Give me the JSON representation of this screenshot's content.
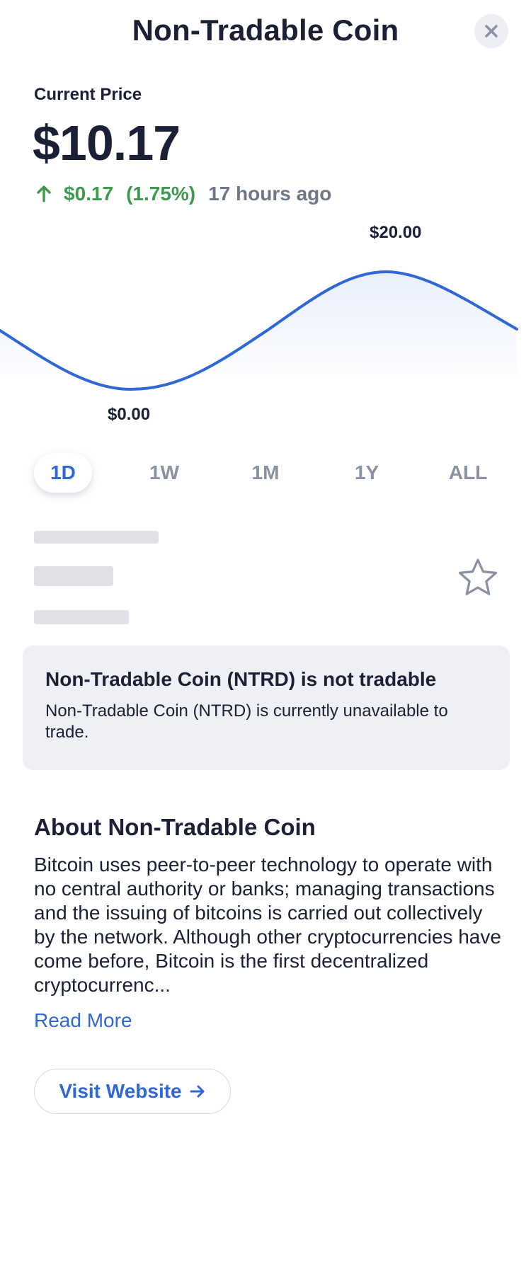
{
  "header": {
    "title": "Non-Tradable Coin"
  },
  "price": {
    "label": "Current Price",
    "value": "$10.17",
    "change_amount": "$0.17",
    "change_percent": "(1.75%)",
    "change_time": "17 hours ago",
    "change_direction": "up"
  },
  "chart_data": {
    "type": "line",
    "max_label": "$20.00",
    "min_label": "$0.00",
    "y_range": [
      0,
      20
    ],
    "line_color": "#2f67d8",
    "fill": "gradient-light-blue"
  },
  "range_tabs": {
    "items": [
      {
        "label": "1D",
        "active": true
      },
      {
        "label": "1W",
        "active": false
      },
      {
        "label": "1M",
        "active": false
      },
      {
        "label": "1Y",
        "active": false
      },
      {
        "label": "ALL",
        "active": false
      }
    ]
  },
  "notice": {
    "title": "Non-Tradable Coin (NTRD) is not tradable",
    "body": "Non-Tradable Coin (NTRD) is currently unavailable to trade."
  },
  "about": {
    "title": "About Non-Tradable Coin",
    "body": "Bitcoin uses peer-to-peer technology to operate with no central authority or banks; managing transactions and the issuing of bitcoins is carried out collectively by the network. Although other cryptocurrencies have come before, Bitcoin is the first decentralized cryptocurrenc...",
    "read_more_label": "Read More",
    "visit_website_label": "Visit Website"
  },
  "icons": {
    "close": "close-icon",
    "change_arrow": "arrow-up-icon",
    "favorite": "star-icon",
    "visit": "arrow-right-icon"
  },
  "colors": {
    "accent": "#2f67d8",
    "positive": "#3f9a4f",
    "muted": "#6e7689",
    "notice_bg": "#eef0f6"
  }
}
